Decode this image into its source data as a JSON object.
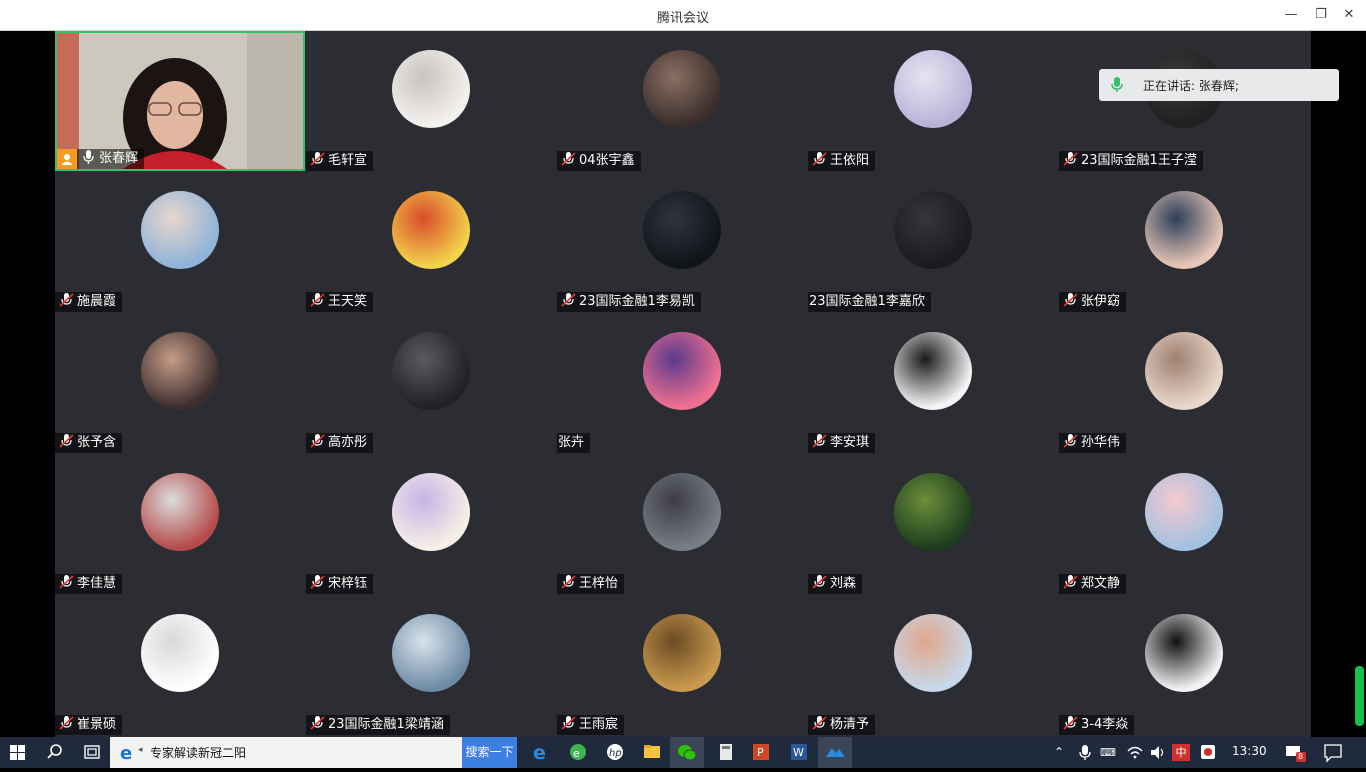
{
  "window": {
    "title": "腾讯会议"
  },
  "speaking": {
    "label": "正在讲话:",
    "names": "张春辉;"
  },
  "participants": [
    {
      "name": "张春辉",
      "host": true
    },
    {
      "name": "毛轩宣"
    },
    {
      "name": "04张宇鑫"
    },
    {
      "name": "王依阳"
    },
    {
      "name": "23国际金融1王子滢"
    },
    {
      "name": "施晨霞"
    },
    {
      "name": "王天笑"
    },
    {
      "name": "23国际金融1李易凯"
    },
    {
      "name": "23国际金融1李嘉欣"
    },
    {
      "name": "张伊窈"
    },
    {
      "name": "张予含"
    },
    {
      "name": "高亦彤"
    },
    {
      "name": "张卉"
    },
    {
      "name": "李安琪"
    },
    {
      "name": "孙华伟"
    },
    {
      "name": "李佳慧"
    },
    {
      "name": "宋梓钰"
    },
    {
      "name": "王梓怡"
    },
    {
      "name": "刘森"
    },
    {
      "name": "郑文静"
    },
    {
      "name": "崔景硕"
    },
    {
      "name": "23国际金融1梁靖涵"
    },
    {
      "name": "王雨宸"
    },
    {
      "name": "杨清予"
    },
    {
      "name": "3-4李焱"
    }
  ],
  "taskbar": {
    "search_text": "专家解读新冠二阳",
    "search_button": "搜索一下",
    "ime": "中",
    "time": "13:30",
    "notification_count": "8"
  },
  "colors": {
    "accent_green": "#36c06a",
    "host_badge": "#f59a23",
    "taskbar": "#1f2b3c"
  }
}
